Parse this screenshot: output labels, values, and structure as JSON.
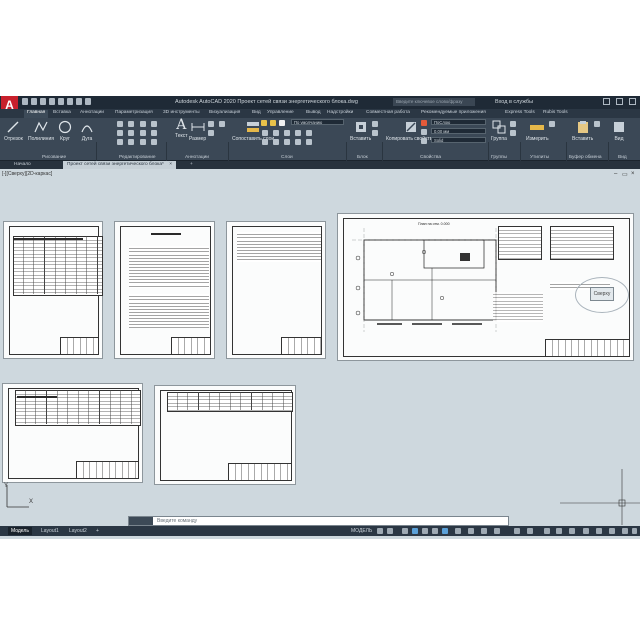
{
  "app": {
    "logo": "A",
    "window_title": "Autodesk AutoCAD 2020   Проект сетей связи энергетического блока.dwg",
    "search_placeholder": "Введите ключевое слово/фразу",
    "user": "Вход в службы",
    "help": "?"
  },
  "ribbon_tabs": [
    "Главная",
    "Вставка",
    "Аннотации",
    "Параметризация",
    "3D инструменты",
    "Визуализация",
    "Вид",
    "Управление",
    "Вывод",
    "Надстройки",
    "Совместная работа",
    "Рекомендуемые приложения",
    "Express Tools",
    "Rubis Tools"
  ],
  "ribbon": {
    "draw_tools": [
      "Отрезок",
      "Полилиния",
      "Круг",
      "Дуга"
    ],
    "text_tool": "Текст",
    "dimension_tool": "Размер",
    "mleader_tool": "Сопоставить слои",
    "layer_combo": "По умолчанию",
    "insert_tool": "Вставить",
    "properties_tool": "Копировать свойства",
    "bylayer_1": "ПоСлою",
    "lineweight": "0.00 мм",
    "bylayer_2": "Solid",
    "group_tool": "Группа",
    "measure_tool": "Измерить",
    "paste_tool": "Вставить",
    "base_tool": "Вид",
    "panels": [
      "Рисование",
      "Редактирование",
      "Аннотации",
      "Слои",
      "Блок",
      "Свойства",
      "Группы",
      "Утилиты",
      "Буфер обмена",
      "Вид"
    ]
  },
  "doc_tabs": {
    "start": "Начало",
    "file": "Проект сетей связи энергетического блока*",
    "close": "×",
    "add": "+"
  },
  "viewport": {
    "label": "[-][Сверху][2D-каркас]",
    "viewcube_label": "Сверху",
    "ucs_x": "X",
    "ucs_y": "Y",
    "min": "–",
    "restore": "▭",
    "close": "×"
  },
  "sheets": {
    "plan_title": "План на отм. 0.000"
  },
  "command_line": {
    "placeholder": "Введите команду"
  },
  "status_bar": {
    "layouts": [
      "Модель",
      "Layout1",
      "Layout2"
    ],
    "add": "+",
    "model_button": "МОДЕЛЬ"
  }
}
